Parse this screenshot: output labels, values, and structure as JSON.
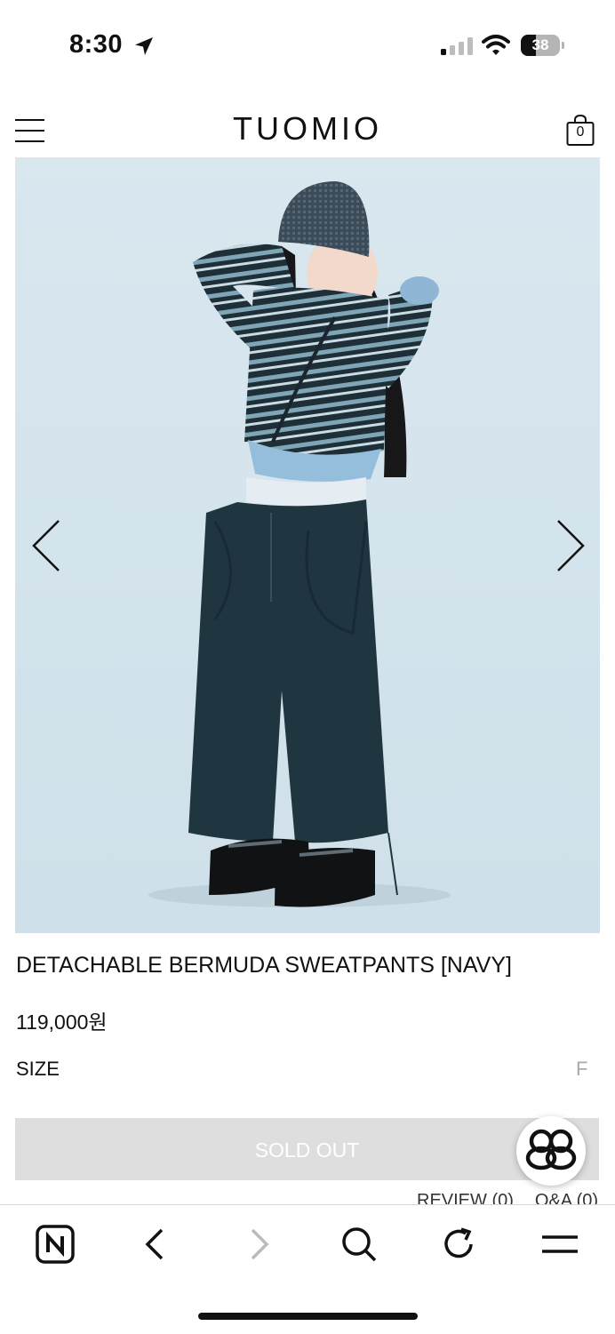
{
  "status_bar": {
    "time": "8:30",
    "battery": "38",
    "battery_level": 0.38
  },
  "header": {
    "logo": "TUOMIO",
    "cart_count": "0"
  },
  "product": {
    "title": "DETACHABLE BERMUDA SWEATPANTS [NAVY]",
    "price": "119,000원",
    "size_label": "SIZE",
    "size_value": "F",
    "sold_out_label": "SOLD OUT"
  },
  "tabs": [
    "REVIEW (0)",
    "Q&A (0)"
  ],
  "toolbar": {
    "icons": [
      "naver-icon",
      "back-icon",
      "forward-icon",
      "search-icon",
      "refresh-icon",
      "menu-icon"
    ]
  },
  "colors": {
    "hero_bg": "#d6e6ee",
    "sold_out_bg": "#dedede",
    "navy": "#1f3540"
  }
}
